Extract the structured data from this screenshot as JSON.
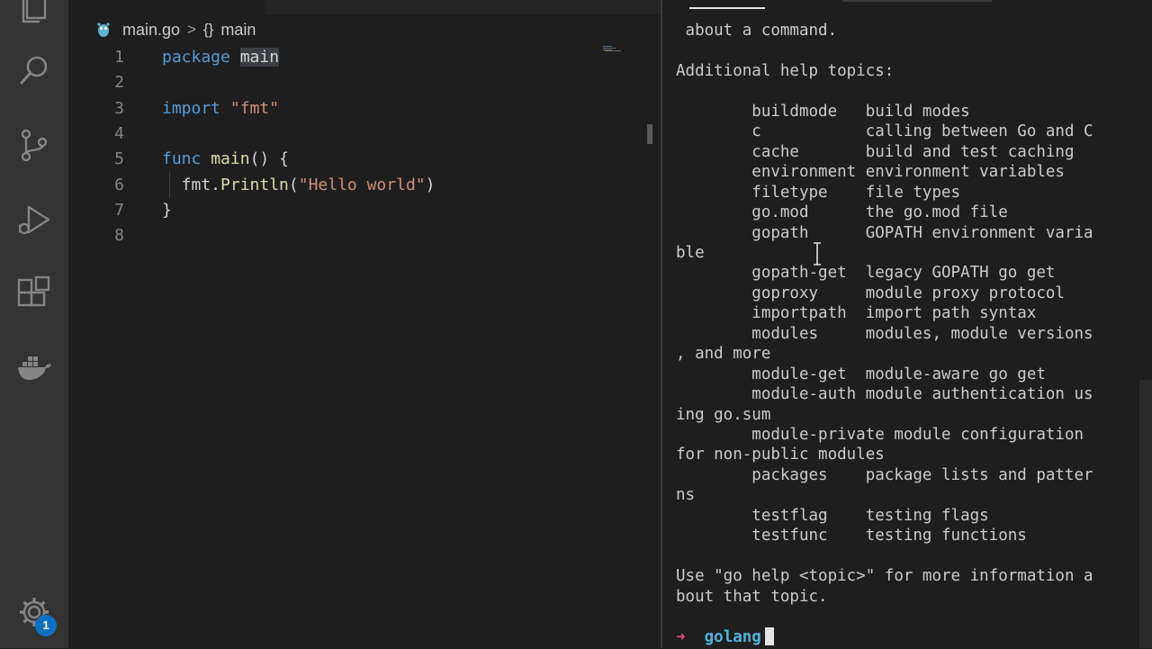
{
  "activity_bar": {
    "icons": [
      "explorer-icon",
      "search-icon",
      "source-control-icon",
      "run-debug-icon",
      "extensions-icon",
      "docker-icon",
      "gear-icon"
    ],
    "settings_badge": "1",
    "badge_color": "#0e70c0"
  },
  "editor": {
    "breadcrumb": {
      "file": "main.go",
      "separator": ">",
      "symbol_icon": "{}",
      "symbol": "main"
    },
    "lines": [
      {
        "num": "1",
        "parts": [
          {
            "t": "package",
            "c": "kw"
          },
          {
            "t": " "
          },
          {
            "t": "main",
            "c": "hl"
          }
        ]
      },
      {
        "num": "2",
        "parts": []
      },
      {
        "num": "3",
        "parts": [
          {
            "t": "import",
            "c": "kw"
          },
          {
            "t": " "
          },
          {
            "t": "\"fmt\"",
            "c": "str"
          }
        ]
      },
      {
        "num": "4",
        "parts": []
      },
      {
        "num": "5",
        "parts": [
          {
            "t": "func",
            "c": "kw"
          },
          {
            "t": " "
          },
          {
            "t": "main",
            "c": "fn"
          },
          {
            "t": "() {"
          }
        ]
      },
      {
        "num": "6",
        "parts": [
          {
            "t": "  fmt."
          },
          {
            "t": "Println",
            "c": "fn"
          },
          {
            "t": "("
          },
          {
            "t": "\"Hello world\"",
            "c": "str"
          },
          {
            "t": ")"
          }
        ]
      },
      {
        "num": "7",
        "parts": [
          {
            "t": "}"
          }
        ]
      },
      {
        "num": "8",
        "parts": []
      }
    ]
  },
  "terminal": {
    "lines": [
      " about a command.",
      "",
      "Additional help topics:",
      "",
      "        buildmode   build modes",
      "        c           calling between Go and C",
      "        cache       build and test caching",
      "        environment environment variables",
      "        filetype    file types",
      "        go.mod      the go.mod file",
      "        gopath      GOPATH environment varia",
      "ble",
      "        gopath-get  legacy GOPATH go get",
      "        goproxy     module proxy protocol",
      "        importpath  import path syntax",
      "        modules     modules, module versions",
      ", and more",
      "        module-get  module-aware go get",
      "        module-auth module authentication us",
      "ing go.sum",
      "        module-private module configuration",
      "for non-public modules",
      "        packages    package lists and patter",
      "ns",
      "        testflag    testing flags",
      "        testfunc    testing functions",
      "",
      "Use \"go help <topic>\" for more information a",
      "bout that topic."
    ],
    "prompt": {
      "arrow": "➜",
      "dir": "golang"
    },
    "colors": {
      "arrow": "#e24b6a",
      "dir": "#4fb3d9"
    }
  }
}
